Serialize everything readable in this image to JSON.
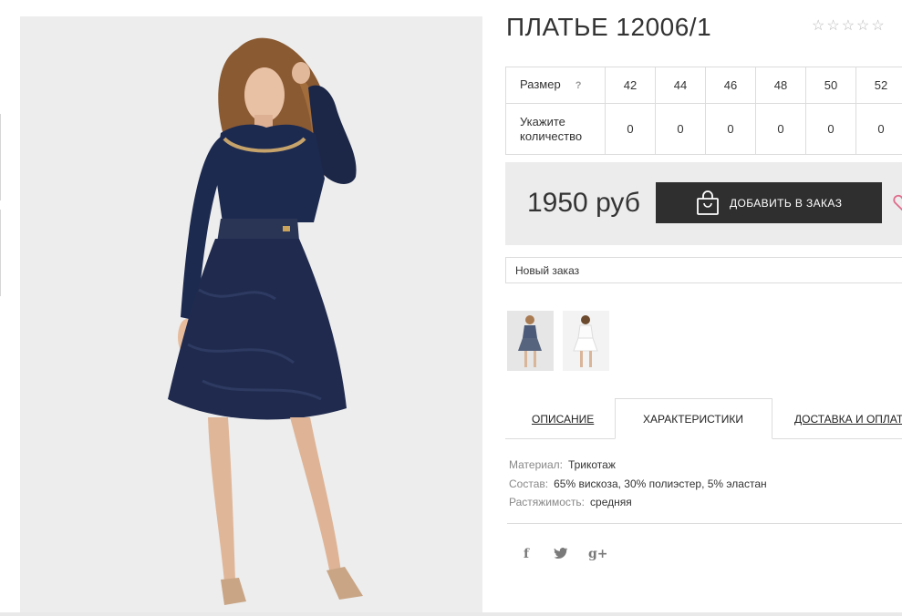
{
  "product": {
    "title": "ПЛАТЬЕ 12006/1",
    "rating": {
      "value": 0,
      "max": 5,
      "star_glyph": "☆"
    }
  },
  "size_table": {
    "size_label": "Размер",
    "help_label": "?",
    "qty_label": "Укажите количество",
    "sizes": [
      "42",
      "44",
      "46",
      "48",
      "50",
      "52"
    ],
    "quantities": [
      "0",
      "0",
      "0",
      "0",
      "0",
      "0"
    ]
  },
  "purchase": {
    "price": "1950 руб",
    "add_button_label": "ДОБАВИТЬ В ЗАКАЗ",
    "bag_icon": "shopping-bag-icon",
    "wishlist_icon": "heart-icon",
    "button_color": "#2f2f2f",
    "heart_color": "#e06b8b"
  },
  "order": {
    "selected": "Новый заказ"
  },
  "thumbnails": [
    {
      "alt": "thumb-navy-dress"
    },
    {
      "alt": "thumb-white-dress"
    }
  ],
  "tabs": [
    {
      "label": "ОПИСАНИЕ",
      "active": false
    },
    {
      "label": "ХАРАКТЕРИСТИКИ",
      "active": true
    },
    {
      "label": "ДОСТАВКА И ОПЛАТА",
      "active": false
    }
  ],
  "specs": [
    {
      "key": "Материал:",
      "value": "Трикотаж"
    },
    {
      "key": "Состав:",
      "value": "65% вискоза, 30% полиэстер, 5% эластан"
    },
    {
      "key": "Растяжимость:",
      "value": "средняя"
    }
  ],
  "social": [
    {
      "icon": "facebook-icon",
      "glyph": "f"
    },
    {
      "icon": "twitter-icon",
      "glyph": "🐦"
    },
    {
      "icon": "google-plus-icon",
      "glyph": "g+"
    }
  ]
}
